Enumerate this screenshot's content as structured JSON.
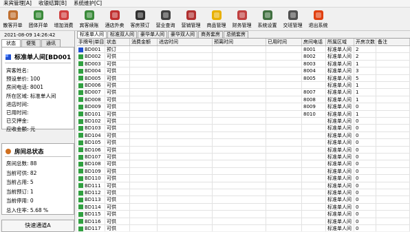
{
  "menu": [
    "来宾管理[A]",
    "收银结算[B]",
    "系统维护[C]"
  ],
  "toolbar": [
    {
      "label": "散客开单",
      "icon": "guest-checkin-icon",
      "color": "#c07030"
    },
    {
      "label": "团体开单",
      "icon": "group-checkin-icon",
      "color": "#3a8a3a"
    },
    {
      "label": "增加消费",
      "icon": "add-consumption-icon",
      "color": "#d04040"
    },
    {
      "label": "宾客续账",
      "icon": "guest-renewal-icon",
      "color": "#3a8a3a"
    },
    {
      "label": "酒店外卖",
      "icon": "takeout-icon",
      "color": "#c03030"
    },
    {
      "label": "客房预订",
      "icon": "room-booking-clock-icon",
      "color": "#303030"
    },
    {
      "label": "营业查询",
      "icon": "business-query-icon",
      "color": "#404040"
    },
    {
      "label": "营销管理",
      "icon": "marketing-icon",
      "color": "#b03030"
    },
    {
      "label": "商品管理",
      "icon": "goods-star-icon",
      "color": "#e8b000"
    },
    {
      "label": "财务管理",
      "icon": "finance-icon",
      "color": "#c04040"
    },
    {
      "label": "系统设置",
      "icon": "settings-icon",
      "color": "#407040"
    },
    {
      "label": "交班管理",
      "icon": "handover-icon",
      "color": "#505050"
    },
    {
      "label": "退出系统",
      "icon": "exit-icon",
      "color": "#e04010"
    }
  ],
  "datetime": "2021-08-09 14:26:42",
  "left_tabs": [
    "状态",
    "便笺",
    "通讯"
  ],
  "room": {
    "title": "标准单人间[BD001",
    "fields": [
      {
        "label": "宾客姓名:",
        "value": ""
      },
      {
        "label": "预设单价:",
        "value": "100"
      },
      {
        "label": "房间电话:",
        "value": "8001"
      },
      {
        "label": "所在区域:",
        "value": "标准单人间"
      },
      {
        "label": "进店时间:",
        "value": ""
      },
      {
        "label": "已用时间:",
        "value": ""
      },
      {
        "label": "已交押金:",
        "value": ""
      },
      {
        "label": "应收金额:",
        "value": "元"
      }
    ]
  },
  "stats": {
    "title": "房间总状态",
    "fields": [
      {
        "label": "房间总数:",
        "value": "88"
      },
      {
        "label": "当前可供:",
        "value": "82"
      },
      {
        "label": "当前占用:",
        "value": "5"
      },
      {
        "label": "当前预订:",
        "value": "1"
      },
      {
        "label": "当前停用:",
        "value": "0"
      },
      {
        "label": "总入住率:",
        "value": "5.68 %"
      }
    ]
  },
  "quick_channel": "快速通道A",
  "room_tabs": [
    "标准单人间",
    "标准双人间",
    "豪华单人间",
    "豪华双人间",
    "商务套房",
    "总统套房"
  ],
  "columns": [
    "手牌号|单目",
    "状态",
    "消费金额",
    "进店时间",
    "预离时间",
    "已用时间",
    "房间电话",
    "所属区域",
    "开房次数",
    "备注"
  ],
  "rows": [
    {
      "id": "BD001",
      "status": "预订",
      "amount": "",
      "in": "",
      "out": "",
      "used": "",
      "phone": "8001",
      "area": "标准单人间",
      "times": "2",
      "note": "",
      "flag": "blue"
    },
    {
      "id": "BD002",
      "status": "可供",
      "amount": "",
      "in": "",
      "out": "",
      "used": "",
      "phone": "8002",
      "area": "标准单人间",
      "times": "2",
      "note": "",
      "flag": "green"
    },
    {
      "id": "BD003",
      "status": "可供",
      "amount": "",
      "in": "",
      "out": "",
      "used": "",
      "phone": "8003",
      "area": "标准单人间",
      "times": "1",
      "note": "",
      "flag": "green"
    },
    {
      "id": "BD004",
      "status": "可供",
      "amount": "",
      "in": "",
      "out": "",
      "used": "",
      "phone": "8004",
      "area": "标准单人间",
      "times": "3",
      "note": "",
      "flag": "green"
    },
    {
      "id": "BD005",
      "status": "可供",
      "amount": "",
      "in": "",
      "out": "",
      "used": "",
      "phone": "8005",
      "area": "标准单人间",
      "times": "5",
      "note": "",
      "flag": "green"
    },
    {
      "id": "BD006",
      "status": "可供",
      "amount": "",
      "in": "",
      "out": "",
      "used": "",
      "phone": "",
      "area": "标准单人间",
      "times": "1",
      "note": "",
      "flag": "green"
    },
    {
      "id": "BD007",
      "status": "可供",
      "amount": "",
      "in": "",
      "out": "",
      "used": "",
      "phone": "8007",
      "area": "标准单人间",
      "times": "1",
      "note": "",
      "flag": "green"
    },
    {
      "id": "BD008",
      "status": "可供",
      "amount": "",
      "in": "",
      "out": "",
      "used": "",
      "phone": "8008",
      "area": "标准单人间",
      "times": "1",
      "note": "",
      "flag": "green"
    },
    {
      "id": "BD009",
      "status": "可供",
      "amount": "",
      "in": "",
      "out": "",
      "used": "",
      "phone": "8009",
      "area": "标准单人间",
      "times": "0",
      "note": "",
      "flag": "green"
    },
    {
      "id": "BD101",
      "status": "可供",
      "amount": "",
      "in": "",
      "out": "",
      "used": "",
      "phone": "8010",
      "area": "标准单人间",
      "times": "1",
      "note": "",
      "flag": "green"
    },
    {
      "id": "BD102",
      "status": "可供",
      "amount": "",
      "in": "",
      "out": "",
      "used": "",
      "phone": "",
      "area": "标准单人间",
      "times": "0",
      "note": "",
      "flag": "green"
    },
    {
      "id": "BD103",
      "status": "可供",
      "amount": "",
      "in": "",
      "out": "",
      "used": "",
      "phone": "",
      "area": "标准单人间",
      "times": "0",
      "note": "",
      "flag": "green"
    },
    {
      "id": "BD104",
      "status": "可供",
      "amount": "",
      "in": "",
      "out": "",
      "used": "",
      "phone": "",
      "area": "标准单人间",
      "times": "0",
      "note": "",
      "flag": "green"
    },
    {
      "id": "BD105",
      "status": "可供",
      "amount": "",
      "in": "",
      "out": "",
      "used": "",
      "phone": "",
      "area": "标准单人间",
      "times": "0",
      "note": "",
      "flag": "green"
    },
    {
      "id": "BD106",
      "status": "可供",
      "amount": "",
      "in": "",
      "out": "",
      "used": "",
      "phone": "",
      "area": "标准单人间",
      "times": "0",
      "note": "",
      "flag": "green"
    },
    {
      "id": "BD107",
      "status": "可供",
      "amount": "",
      "in": "",
      "out": "",
      "used": "",
      "phone": "",
      "area": "标准单人间",
      "times": "0",
      "note": "",
      "flag": "green"
    },
    {
      "id": "BD108",
      "status": "可供",
      "amount": "",
      "in": "",
      "out": "",
      "used": "",
      "phone": "",
      "area": "标准单人间",
      "times": "0",
      "note": "",
      "flag": "green"
    },
    {
      "id": "BD109",
      "status": "可供",
      "amount": "",
      "in": "",
      "out": "",
      "used": "",
      "phone": "",
      "area": "标准单人间",
      "times": "0",
      "note": "",
      "flag": "green"
    },
    {
      "id": "BD110",
      "status": "可供",
      "amount": "",
      "in": "",
      "out": "",
      "used": "",
      "phone": "",
      "area": "标准单人间",
      "times": "0",
      "note": "",
      "flag": "green"
    },
    {
      "id": "BD111",
      "status": "可供",
      "amount": "",
      "in": "",
      "out": "",
      "used": "",
      "phone": "",
      "area": "标准单人间",
      "times": "0",
      "note": "",
      "flag": "green"
    },
    {
      "id": "BD112",
      "status": "可供",
      "amount": "",
      "in": "",
      "out": "",
      "used": "",
      "phone": "",
      "area": "标准单人间",
      "times": "0",
      "note": "",
      "flag": "green"
    },
    {
      "id": "BD113",
      "status": "可供",
      "amount": "",
      "in": "",
      "out": "",
      "used": "",
      "phone": "",
      "area": "标准单人间",
      "times": "0",
      "note": "",
      "flag": "green"
    },
    {
      "id": "BD114",
      "status": "可供",
      "amount": "",
      "in": "",
      "out": "",
      "used": "",
      "phone": "",
      "area": "标准单人间",
      "times": "0",
      "note": "",
      "flag": "green"
    },
    {
      "id": "BD115",
      "status": "可供",
      "amount": "",
      "in": "",
      "out": "",
      "used": "",
      "phone": "",
      "area": "标准单人间",
      "times": "0",
      "note": "",
      "flag": "green"
    },
    {
      "id": "BD116",
      "status": "可供",
      "amount": "",
      "in": "",
      "out": "",
      "used": "",
      "phone": "",
      "area": "标准单人间",
      "times": "0",
      "note": "",
      "flag": "green"
    },
    {
      "id": "BD117",
      "status": "可供",
      "amount": "",
      "in": "",
      "out": "",
      "used": "",
      "phone": "",
      "area": "标准单人间",
      "times": "0",
      "note": "",
      "flag": "green"
    }
  ],
  "colors": {
    "flag_blue": "#2050d0",
    "flag_green": "#30a040"
  }
}
